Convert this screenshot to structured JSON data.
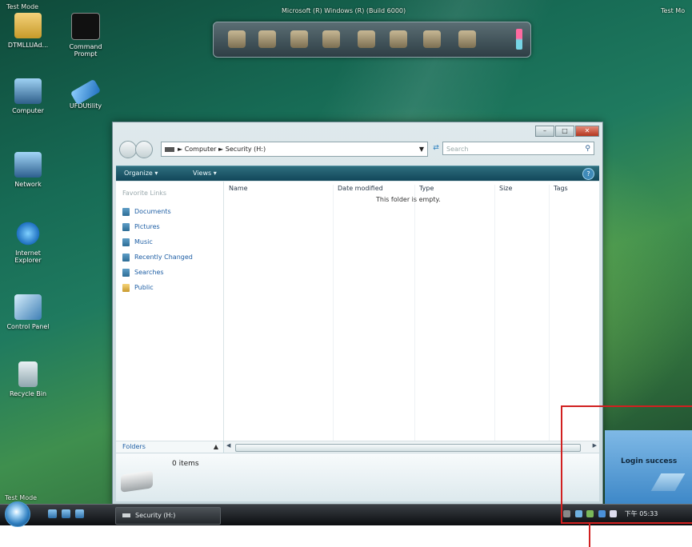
{
  "desktop": {
    "watermark_top_left": "Test Mode",
    "watermark_top_center": "Microsoft (R) Windows (R) (Build 6000)",
    "watermark_top_right": "Test Mo",
    "watermark_bottom_left": "Test Mode",
    "icons": [
      {
        "label": "DTMLLUAd...",
        "icon": "folder-icon"
      },
      {
        "label": "Command Prompt",
        "icon": "command-prompt-icon"
      },
      {
        "label": "Computer",
        "icon": "computer-icon"
      },
      {
        "label": "UFDUtility",
        "icon": "usb-drive-icon"
      },
      {
        "label": "Network",
        "icon": "network-icon"
      },
      {
        "label": "Internet Explorer",
        "icon": "internet-explorer-icon"
      },
      {
        "label": "Control Panel",
        "icon": "control-panel-icon"
      },
      {
        "label": "Recycle Bin",
        "icon": "recycle-bin-icon"
      }
    ]
  },
  "explorer": {
    "address": {
      "root": "Computer",
      "sep": "►",
      "folder": "Security (H:)"
    },
    "search_placeholder": "Search",
    "toolbar": {
      "organize": "Organize ▾",
      "views": "Views ▾"
    },
    "favorites_heading": "Favorite Links",
    "favorites": [
      "Documents",
      "Pictures",
      "Music",
      "Recently Changed",
      "Searches",
      "Public"
    ],
    "folders_label": "Folders",
    "columns": [
      "Name",
      "Date modified",
      "Type",
      "Size",
      "Tags"
    ],
    "empty_text": "This folder is empty.",
    "item_count": "0 items"
  },
  "notification": {
    "text": "Login success"
  },
  "taskbar": {
    "task_label": "Security (H:)",
    "clock": "下午 05:33"
  },
  "colors": {
    "highlight_box": "#d12020",
    "toolbar": "#12475a",
    "link": "#1f5fa5"
  }
}
